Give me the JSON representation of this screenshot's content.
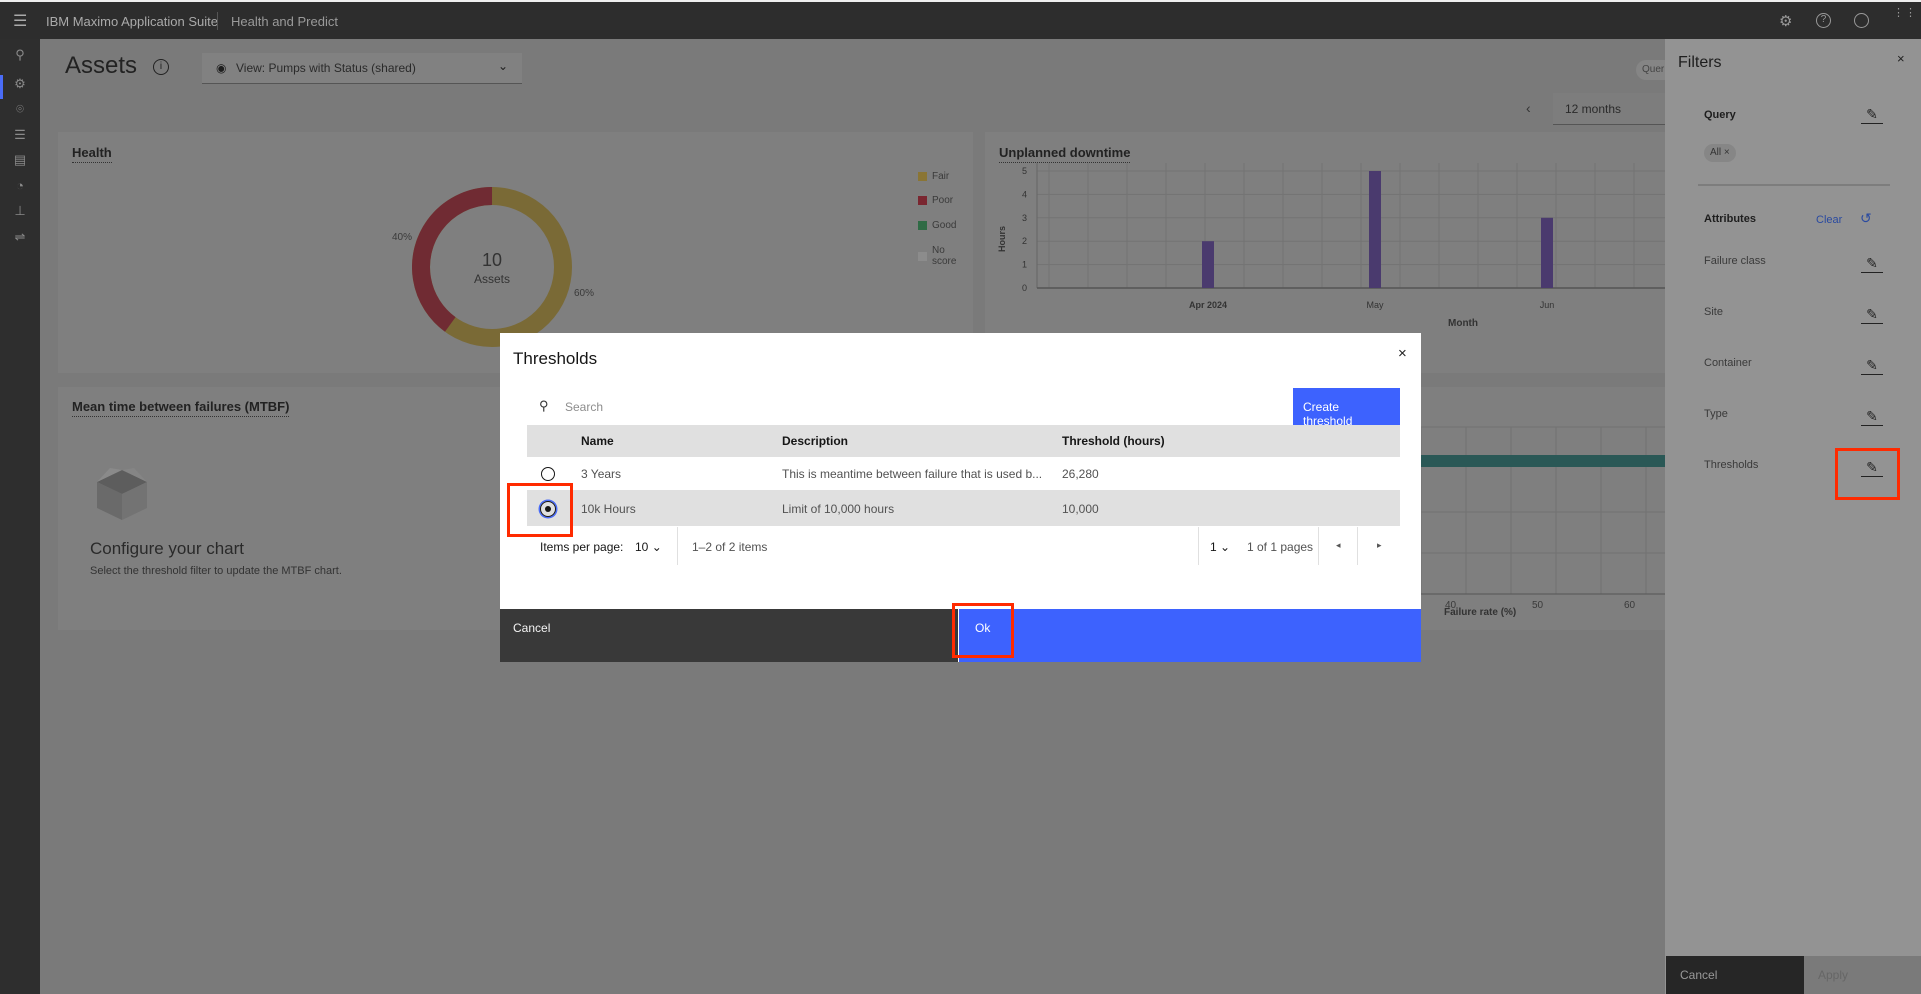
{
  "topbar": {
    "app_name": "IBM Maximo Application Suite",
    "module": "Health and Predict",
    "icons": [
      "settings-icon",
      "help-icon",
      "user-icon",
      "app-switcher-icon"
    ]
  },
  "leftnav": {
    "icons": [
      "search-icon",
      "assets-icon",
      "location-icon",
      "checklist-icon",
      "report-icon",
      "gauge-icon",
      "hierarchy-icon",
      "settings-sliders-icon"
    ],
    "active_color": "#4a6cf7"
  },
  "page": {
    "title": "Assets",
    "view_label": "View: Pumps with Status (shared)",
    "query_chip": "Quer",
    "time_range": "12 months"
  },
  "health": {
    "title": "Health",
    "center_value": "10",
    "center_label": "Assets",
    "slices": [
      {
        "label": "Fair",
        "percent": 60,
        "label_text": "60%",
        "color": "#7a6a36"
      },
      {
        "label": "Poor",
        "percent": 40,
        "label_text": "40%",
        "color": "#702b33"
      }
    ],
    "legend": [
      {
        "label": "Fair",
        "color": "#8a7535"
      },
      {
        "label": "Poor",
        "color": "#7a2630"
      },
      {
        "label": "Good",
        "color": "#2f6b45"
      },
      {
        "label": "No score",
        "color": "#8c8c8c"
      }
    ]
  },
  "chart_data": {
    "type": "bar",
    "title": "Unplanned downtime",
    "xlabel": "Month",
    "ylabel": "Hours",
    "ylim": [
      0,
      5
    ],
    "yticks": [
      "0",
      "1",
      "2",
      "3",
      "4",
      "5"
    ],
    "categories": [
      "Apr 2024",
      "May",
      "Jun"
    ],
    "values": [
      2,
      5,
      3
    ],
    "color": "#4a3a6e",
    "grid": true
  },
  "mtbf": {
    "title": "Mean time between failures (MTBF)",
    "empty_title": "Configure your chart",
    "empty_text": "Select the threshold filter to update the MTBF chart."
  },
  "failure_rate": {
    "xlabel": "Failure rate (%)",
    "ticks": [
      "40",
      "50",
      "60"
    ],
    "bar_color": "#2a5856"
  },
  "filters": {
    "title": "Filters",
    "query_label": "Query",
    "query_chip": "All",
    "attributes_label": "Attributes",
    "clear_label": "Clear",
    "attributes": [
      "Failure class",
      "Site",
      "Container",
      "Type",
      "Thresholds"
    ],
    "cancel": "Cancel",
    "apply": "Apply"
  },
  "modal": {
    "title": "Thresholds",
    "search_placeholder": "Search",
    "create_button": "Create threshold",
    "columns": [
      "Name",
      "Description",
      "Threshold (hours)"
    ],
    "rows": [
      {
        "name": "3 Years",
        "description": "This is meantime between failure that is used b...",
        "threshold": "26,280",
        "selected": false
      },
      {
        "name": "10k Hours",
        "description": "Limit of 10,000 hours",
        "threshold": "10,000",
        "selected": true
      }
    ],
    "items_per_page_label": "Items per page:",
    "items_per_page": "10",
    "range_text": "1–2 of 2 items",
    "page": "1",
    "pages_text": "1 of 1 pages",
    "cancel": "Cancel",
    "ok": "Ok"
  }
}
